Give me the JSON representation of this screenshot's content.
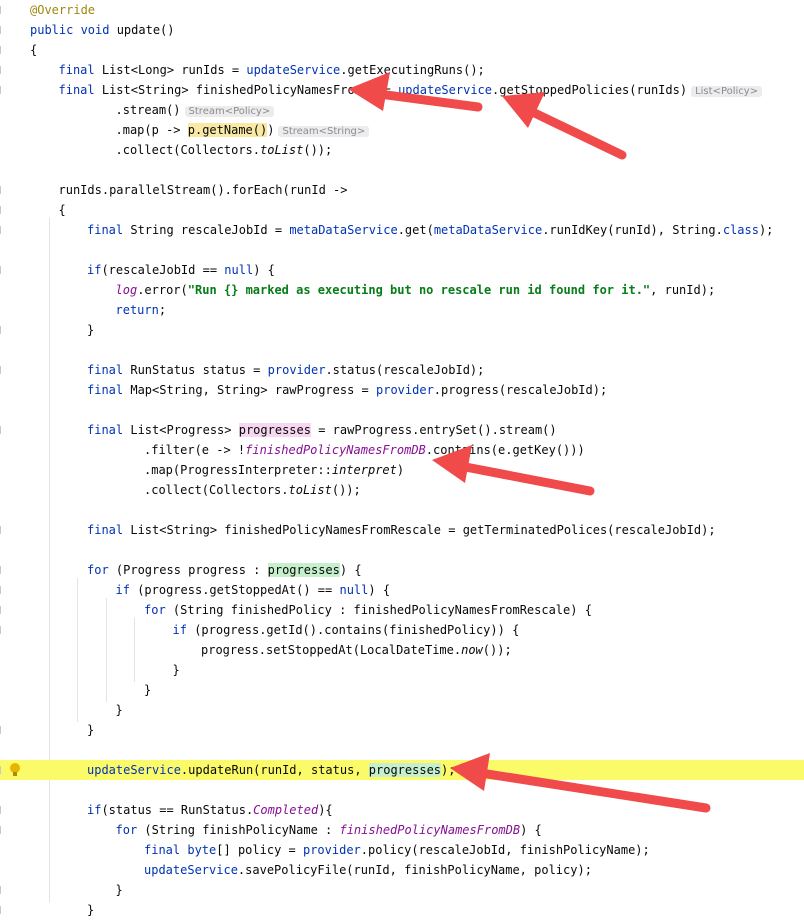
{
  "editor": {
    "lines": [
      {
        "segs": [
          {
            "t": "@Override",
            "c": "ann"
          }
        ]
      },
      {
        "segs": [
          {
            "t": "public ",
            "c": "kw"
          },
          {
            "t": "void ",
            "c": "kw"
          },
          {
            "t": "update()"
          }
        ]
      },
      {
        "segs": [
          {
            "t": "{"
          }
        ]
      },
      {
        "segs": [
          {
            "t": "final ",
            "c": "kw"
          },
          {
            "t": "List<Long> runIds = "
          },
          {
            "t": "updateService",
            "c": "svc"
          },
          {
            "t": ".getExecutingRuns();"
          }
        ]
      },
      {
        "segs": [
          {
            "t": "final ",
            "c": "kw"
          },
          {
            "t": "List<String> finishedPolicyNamesFromDB = "
          },
          {
            "t": "updateService",
            "c": "svc"
          },
          {
            "t": ".getStoppedPolicies(runIds)"
          },
          {
            "t": "List<Policy>",
            "c": "hint"
          }
        ]
      },
      {
        "segs": [
          {
            "t": ".stream()"
          },
          {
            "t": "Stream<Policy>",
            "c": "hint"
          }
        ]
      },
      {
        "segs": [
          {
            "t": ".map(p -> "
          },
          {
            "t": "p.getName()",
            "c": "hl-yellow"
          },
          {
            "t": ")"
          },
          {
            "t": "Stream<String>",
            "c": "hint"
          }
        ]
      },
      {
        "segs": [
          {
            "t": ".collect(Collectors."
          },
          {
            "t": "toList",
            "c": "it"
          },
          {
            "t": "());"
          }
        ]
      },
      {
        "segs": []
      },
      {
        "segs": [
          {
            "t": "runIds.parallelStream().forEach(runId ->"
          }
        ]
      },
      {
        "segs": [
          {
            "t": "{"
          }
        ]
      },
      {
        "segs": [
          {
            "t": "final ",
            "c": "kw"
          },
          {
            "t": "String rescaleJobId = "
          },
          {
            "t": "metaDataService",
            "c": "svc"
          },
          {
            "t": ".get("
          },
          {
            "t": "metaDataService",
            "c": "svc"
          },
          {
            "t": ".runIdKey(runId), String."
          },
          {
            "t": "class",
            "c": "kw"
          },
          {
            "t": ");"
          }
        ]
      },
      {
        "segs": []
      },
      {
        "segs": [
          {
            "t": "if",
            "c": "kw"
          },
          {
            "t": "(rescaleJobId == "
          },
          {
            "t": "null",
            "c": "kw"
          },
          {
            "t": ") {"
          }
        ]
      },
      {
        "segs": [
          {
            "t": "log",
            "c": "itp"
          },
          {
            "t": ".error("
          },
          {
            "t": "\"Run {} marked as executing but no rescale run id found for it.\"",
            "c": "str"
          },
          {
            "t": ", runId);"
          }
        ]
      },
      {
        "segs": [
          {
            "t": "return",
            "c": "kw"
          },
          {
            "t": ";"
          }
        ]
      },
      {
        "segs": [
          {
            "t": "}"
          }
        ]
      },
      {
        "segs": []
      },
      {
        "segs": [
          {
            "t": "final ",
            "c": "kw"
          },
          {
            "t": "RunStatus status = "
          },
          {
            "t": "provider",
            "c": "svc"
          },
          {
            "t": ".status(rescaleJobId);"
          }
        ]
      },
      {
        "segs": [
          {
            "t": "final ",
            "c": "kw"
          },
          {
            "t": "Map<String, String> rawProgress = "
          },
          {
            "t": "provider",
            "c": "svc"
          },
          {
            "t": ".progress(rescaleJobId);"
          }
        ]
      },
      {
        "segs": []
      },
      {
        "segs": [
          {
            "t": "final ",
            "c": "kw"
          },
          {
            "t": "List<Progress> "
          },
          {
            "t": "progresses",
            "c": "hl-pink"
          },
          {
            "t": " = rawProgress.entrySet().stream()"
          }
        ]
      },
      {
        "segs": [
          {
            "t": ".filter(e -> !"
          },
          {
            "t": "finishedPolicyNamesFromDB",
            "c": "itp"
          },
          {
            "t": ".contains(e.getKey()))"
          }
        ]
      },
      {
        "segs": [
          {
            "t": ".map(ProgressInterpreter::"
          },
          {
            "t": "interpret",
            "c": "it"
          },
          {
            "t": ")"
          }
        ]
      },
      {
        "segs": [
          {
            "t": ".collect(Collectors."
          },
          {
            "t": "toList",
            "c": "it"
          },
          {
            "t": "());"
          }
        ]
      },
      {
        "segs": []
      },
      {
        "segs": [
          {
            "t": "final ",
            "c": "kw"
          },
          {
            "t": "List<String> finishedPolicyNamesFromRescale = getTerminatedPolices(rescaleJobId);"
          }
        ]
      },
      {
        "segs": []
      },
      {
        "segs": [
          {
            "t": "for ",
            "c": "kw"
          },
          {
            "t": "(Progress progress : "
          },
          {
            "t": "progresses",
            "c": "hl-green"
          },
          {
            "t": ") {"
          }
        ]
      },
      {
        "segs": [
          {
            "t": "if ",
            "c": "kw"
          },
          {
            "t": "(progress.getStoppedAt() == "
          },
          {
            "t": "null",
            "c": "kw"
          },
          {
            "t": ") {"
          }
        ]
      },
      {
        "segs": [
          {
            "t": "for ",
            "c": "kw"
          },
          {
            "t": "(String finishedPolicy : finishedPolicyNamesFromRescale) {"
          }
        ]
      },
      {
        "segs": [
          {
            "t": "if ",
            "c": "kw"
          },
          {
            "t": "(progress.getId().contains(finishedPolicy)) {"
          }
        ]
      },
      {
        "segs": [
          {
            "t": "progress.setStoppedAt(LocalDateTime."
          },
          {
            "t": "now",
            "c": "it"
          },
          {
            "t": "());"
          }
        ]
      },
      {
        "segs": [
          {
            "t": "}"
          }
        ]
      },
      {
        "segs": [
          {
            "t": "}"
          }
        ]
      },
      {
        "segs": [
          {
            "t": "}"
          }
        ]
      },
      {
        "segs": [
          {
            "t": "}"
          }
        ]
      },
      {
        "segs": []
      },
      {
        "segs": [
          {
            "t": "updateService",
            "c": "svc"
          },
          {
            "t": ".updateRun(runId, status, "
          },
          {
            "t": "progresses",
            "c": "hl-green"
          },
          {
            "t": ");"
          }
        ]
      },
      {
        "segs": []
      },
      {
        "segs": [
          {
            "t": "if",
            "c": "kw"
          },
          {
            "t": "(status == RunStatus."
          },
          {
            "t": "Completed",
            "c": "itp"
          },
          {
            "t": "){"
          }
        ]
      },
      {
        "segs": [
          {
            "t": "for ",
            "c": "kw"
          },
          {
            "t": "(String finishPolicyName : "
          },
          {
            "t": "finishedPolicyNamesFromDB",
            "c": "itp"
          },
          {
            "t": ") {"
          }
        ]
      },
      {
        "segs": [
          {
            "t": "final ",
            "c": "kw"
          },
          {
            "t": "byte",
            "c": "kw"
          },
          {
            "t": "[] policy = "
          },
          {
            "t": "provider",
            "c": "svc"
          },
          {
            "t": ".policy(rescaleJobId, finishPolicyName);"
          }
        ]
      },
      {
        "segs": [
          {
            "t": "updateService",
            "c": "svc"
          },
          {
            "t": ".savePolicyFile(runId, finishPolicyName, policy);"
          }
        ]
      },
      {
        "segs": [
          {
            "t": "}"
          }
        ]
      },
      {
        "segs": [
          {
            "t": "}"
          }
        ]
      }
    ]
  },
  "colors": {
    "keyword": "#0033b3",
    "annotation": "#9e880d",
    "string": "#067d17",
    "field": "#871094",
    "current_line": "#fbfb6a",
    "arrow": "#f04a4a"
  },
  "icons": [
    "intention-bulb-icon"
  ]
}
